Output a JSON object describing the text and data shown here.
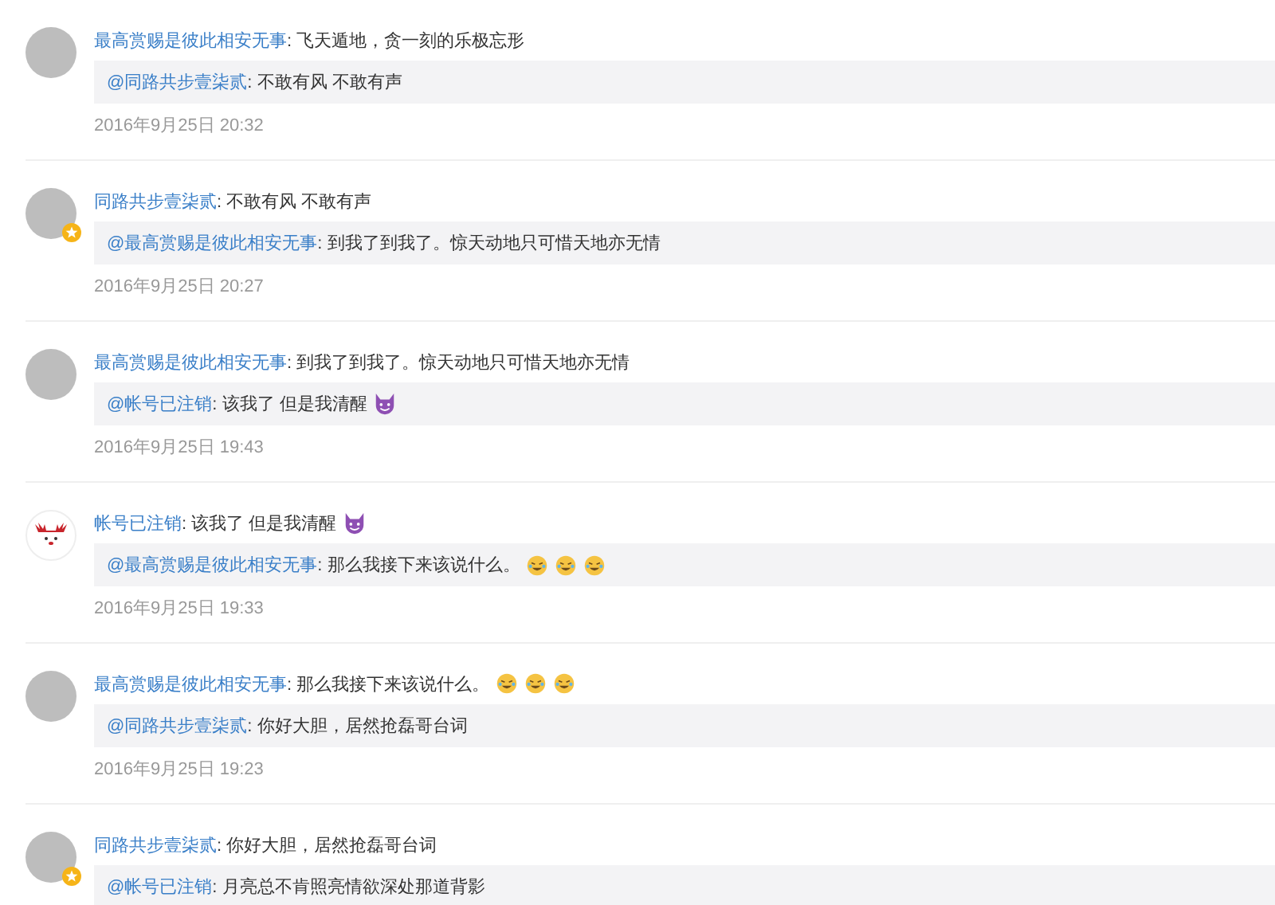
{
  "comments": [
    {
      "avatar": {
        "kind": "photo",
        "badge": false
      },
      "author": "最高赏赐是彼此相安无事",
      "text": ": 飞天遁地，贪一刻的乐极忘形",
      "quote": {
        "author": "@同路共步壹柒贰",
        "text": ": 不敢有风 不敢有声"
      },
      "time": "2016年9月25日 20:32"
    },
    {
      "avatar": {
        "kind": "photo",
        "badge": true
      },
      "author": "同路共步壹柒贰",
      "text": ": 不敢有风 不敢有声",
      "quote": {
        "author": "@最高赏赐是彼此相安无事",
        "text": ": 到我了到我了。惊天动地只可惜天地亦无情"
      },
      "time": "2016年9月25日 20:27"
    },
    {
      "avatar": {
        "kind": "photo",
        "badge": false
      },
      "author": "最高赏赐是彼此相安无事",
      "text": ": 到我了到我了。惊天动地只可惜天地亦无情",
      "quote": {
        "author": "@帐号已注销",
        "text": ": 该我了 但是我清醒",
        "emojis": [
          {
            "kind": "devil"
          }
        ]
      },
      "time": "2016年9月25日 19:43"
    },
    {
      "avatar": {
        "kind": "cartoon",
        "badge": false
      },
      "author": "帐号已注销",
      "text": ": 该我了 但是我清醒",
      "emojis": [
        {
          "kind": "devil"
        }
      ],
      "quote": {
        "author": "@最高赏赐是彼此相安无事",
        "text": ": 那么我接下来该说什么。",
        "emojis": [
          {
            "kind": "laugh"
          },
          {
            "kind": "laugh"
          },
          {
            "kind": "laugh"
          }
        ]
      },
      "time": "2016年9月25日 19:33"
    },
    {
      "avatar": {
        "kind": "photo",
        "badge": false
      },
      "author": "最高赏赐是彼此相安无事",
      "text": ": 那么我接下来该说什么。",
      "emojis": [
        {
          "kind": "laugh"
        },
        {
          "kind": "laugh"
        },
        {
          "kind": "laugh"
        }
      ],
      "quote": {
        "author": "@同路共步壹柒贰",
        "text": ": 你好大胆，居然抢磊哥台词"
      },
      "time": "2016年9月25日 19:23"
    },
    {
      "avatar": {
        "kind": "photo",
        "badge": true
      },
      "author": "同路共步壹柒贰",
      "text": ": 你好大胆，居然抢磊哥台词",
      "quote": {
        "author": "@帐号已注销",
        "text": ": 月亮总不肯照亮情欲深处那道背影"
      }
    }
  ]
}
